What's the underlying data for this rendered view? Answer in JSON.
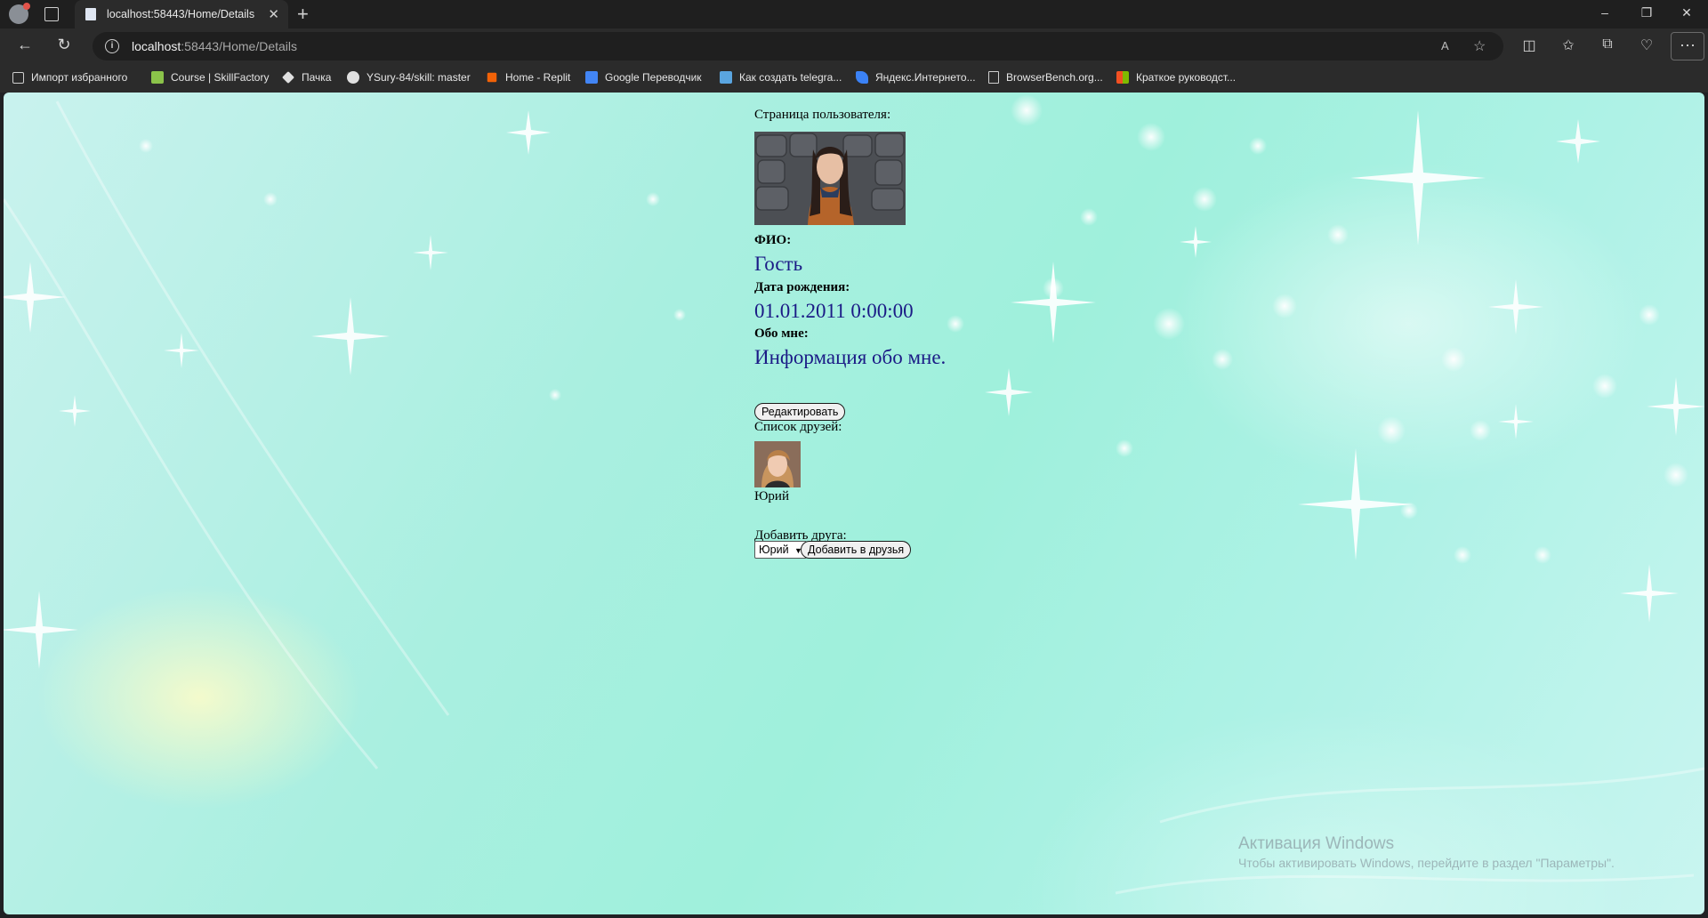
{
  "browser": {
    "tab_title": "localhost:58443/Home/Details",
    "tab_close": "✕",
    "new_tab": "+",
    "window_controls": [
      "–",
      "❐",
      "✕"
    ],
    "url_host": "localhost",
    "url_rest": ":58443/Home/Details",
    "menu": "···"
  },
  "bookmarks": [
    {
      "label": "Импорт избранного",
      "icon": "import-icon",
      "color": "#cfcfcf"
    },
    {
      "label": "Course | SkillFactory",
      "icon": "skillfactory-icon",
      "color": "#8bc34a"
    },
    {
      "label": "Пачка",
      "icon": "pachka-icon",
      "color": "#e0e0e0"
    },
    {
      "label": "YSury-84/skill: master",
      "icon": "github-icon",
      "color": "#e0e0e0"
    },
    {
      "label": "Home - Replit",
      "icon": "replit-icon",
      "color": "#f26207"
    },
    {
      "label": "Google Переводчик",
      "icon": "google-translate-icon",
      "color": "#4285f4"
    },
    {
      "label": "Как создать telegra...",
      "icon": "telegram-icon",
      "color": "#5aa5e0"
    },
    {
      "label": "Яндекс.Интернето...",
      "icon": "yandex-icon",
      "color": "#3b82f6"
    },
    {
      "label": "BrowserBench.org...",
      "icon": "document-icon",
      "color": "#cfcfcf"
    },
    {
      "label": "Краткое руководст...",
      "icon": "microsoft-icon",
      "color": "#f25022"
    }
  ],
  "page": {
    "heading": "Страница пользователя:",
    "fio_label": "ФИО:",
    "fio_value": "Гость",
    "birth_label": "Дата рождения:",
    "birth_value": "01.01.2011 0:00:00",
    "about_label": "Обо мне:",
    "about_value": "Информация обо мне.",
    "edit_button": "Редактировать",
    "friends_label": "Список друзей:",
    "friend_name": "Юрий",
    "add_friend_label": "Добавить друга:",
    "add_friend_select": "Юрий",
    "add_friend_button": "Добавить в друзья"
  },
  "watermark": {
    "title": "Активация Windows",
    "subtitle": "Чтобы активировать Windows, перейдите в раздел \"Параметры\"."
  }
}
